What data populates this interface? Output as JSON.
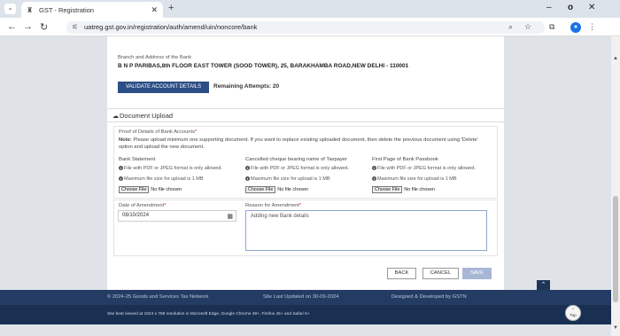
{
  "browser": {
    "tab_title": "GST - Registration",
    "new_tab": "+",
    "url": "uatreg.gst.gov.in/registration/auth/amend/uin/noncore/bank",
    "window": {
      "minimize": "–",
      "maximize": "o",
      "close": "✕"
    }
  },
  "bank": {
    "branch_label": "Branch and Address of the Bank",
    "branch_value": "B N P PARIBAS,8th FLOOR EAST TOWER (SOOD TOWER), 25, BARAKHAMBA ROAD,NEW DELHI - 110001",
    "validate_label": "VALIDATE ACCOUNT DETAILS",
    "remaining": "Remaining Attempts: 20"
  },
  "document_upload": {
    "title": "Document Upload",
    "proof_label": "Proof of Details of Bank Accounts",
    "note_bold": "Note:",
    "note_text": " Please upload minimum one supporting document. If you want to replace existing uploaded document, then delete the previous document using 'Delete' option and upload the new document.",
    "columns": [
      {
        "title": "Bank Statement"
      },
      {
        "title": "Cancelled cheque bearing name of Taxpayer"
      },
      {
        "title": "First Page of Bank Passbook"
      }
    ],
    "format_info": "File with PDF or JPEG format is only allowed.",
    "size_info": "Maximum file size for upload is 1 MB",
    "choose_label": "Choose File",
    "no_file": "No file chosen"
  },
  "amendment": {
    "date_label": "Date of Amendment",
    "date_value": "08/10/2024",
    "reason_label": "Reason for Amendment",
    "reason_value": "Adding new Bank details"
  },
  "actions": {
    "back": "BACK",
    "cancel": "CANCEL",
    "save": "SAVE"
  },
  "footer": {
    "copyright": "© 2024-25 Goods and Services Tax Network",
    "updated": "Site Last Updated on 30-09-2024",
    "designed": "Designed & Developed by GSTN",
    "best_viewed": "Site best viewed at 1024 x 768 resolution in Microsoft Edge, Google Chrome 49+, Firefox 45+ and Safari 6+",
    "top": "Top"
  }
}
